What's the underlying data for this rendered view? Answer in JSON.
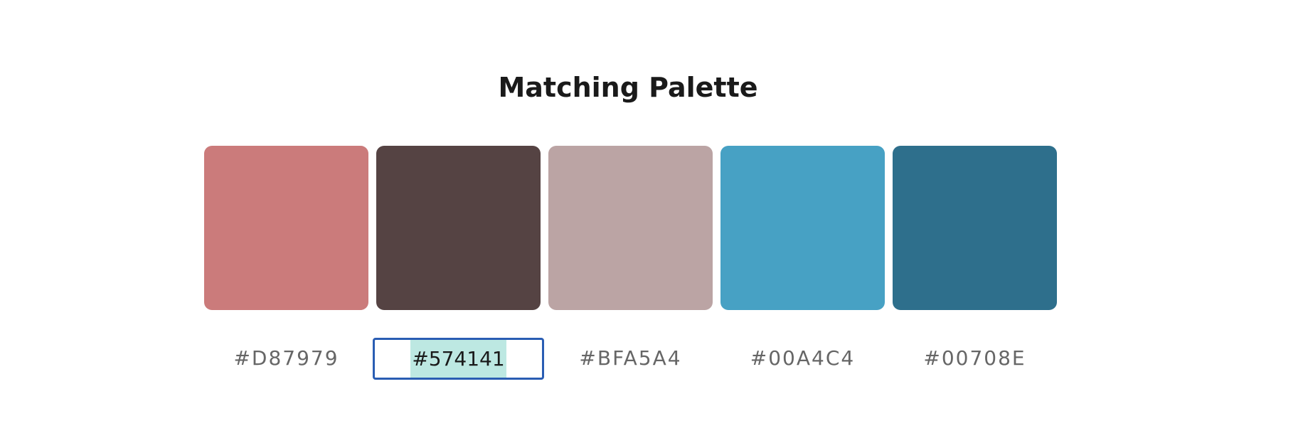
{
  "title": "Matching Palette",
  "palette": [
    {
      "color": "#CB7B7B",
      "hex_label": "#D87979"
    },
    {
      "color": "#554343",
      "hex_label": "#574141"
    },
    {
      "color": "#BBA4A4",
      "hex_label": "#BFA5A4"
    },
    {
      "color": "#47A1C4",
      "hex_label": "#00A4C4"
    },
    {
      "color": "#2E6F8C",
      "hex_label": "#00708E"
    }
  ],
  "active_field": {
    "value": "#574141",
    "selected": true,
    "border_color": "#2A5DB3",
    "selection_color": "#BDE8E2"
  }
}
